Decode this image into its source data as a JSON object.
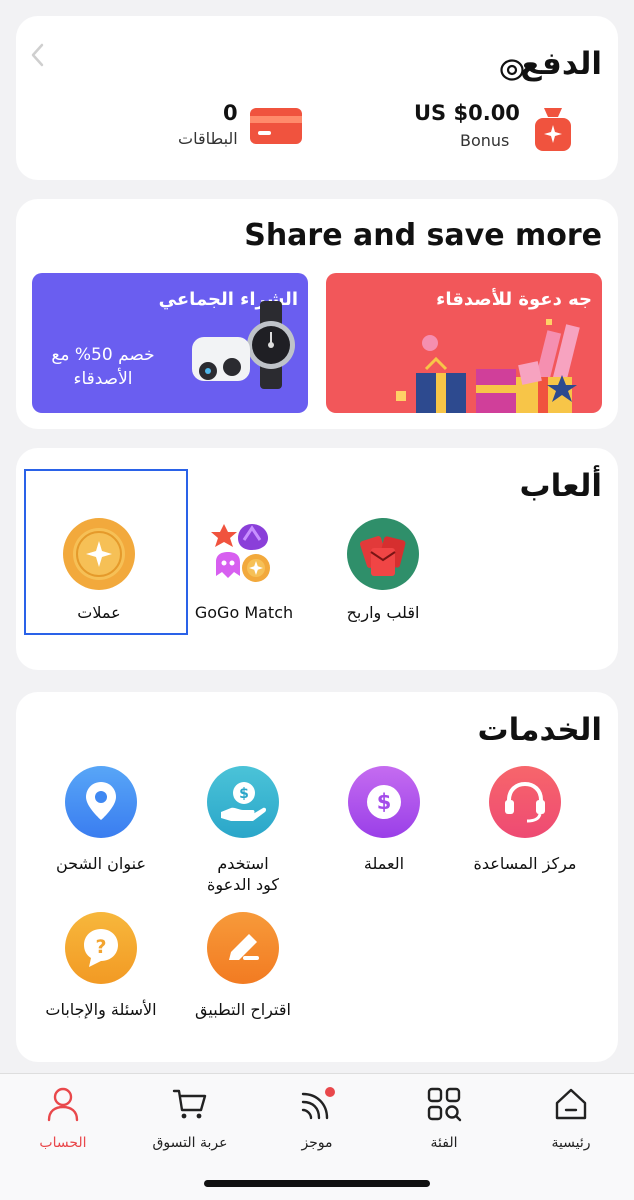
{
  "payment": {
    "title": "الدفع",
    "bonus_value": "US $0.00",
    "bonus_label": "Bonus",
    "cards_count": "0",
    "cards_label": "البطاقات"
  },
  "share": {
    "title": "Share and save more",
    "invite_title": "جه دعوة للأصدقاء",
    "group_title": "الشراء الجماعي",
    "group_sub": "خصم 50% مع الأصدقاء"
  },
  "games": {
    "title": "ألعاب",
    "items": [
      {
        "label": "اقلب واربح",
        "icon": "red-envelopes-icon"
      },
      {
        "label": "GoGo Match",
        "icon": "gogo-match-icon"
      },
      {
        "label": "عملات",
        "icon": "coin-icon"
      }
    ]
  },
  "services": {
    "title": "الخدمات",
    "items": [
      {
        "label": "مركز المساعدة",
        "icon": "headset-icon"
      },
      {
        "label": "العملة",
        "icon": "dollar-icon"
      },
      {
        "label": "استخدم كود الدعوة",
        "label_line1": "استخدم",
        "label_line2": "كود الدعوة",
        "icon": "hand-coin-icon"
      },
      {
        "label": "عنوان الشحن",
        "icon": "location-pin-icon"
      },
      {
        "label": "اقتراح التطبيق",
        "icon": "pencil-icon"
      },
      {
        "label": "الأسئلة والإجابات",
        "icon": "question-icon"
      }
    ]
  },
  "nav": {
    "items": [
      {
        "label": "رئيسية",
        "icon": "home-icon"
      },
      {
        "label": "الفئة",
        "icon": "category-icon"
      },
      {
        "label": "موجز",
        "icon": "feed-icon"
      },
      {
        "label": "عربة التسوق",
        "icon": "cart-icon"
      },
      {
        "label": "الحساب",
        "icon": "account-icon"
      }
    ],
    "active_color": "#e9484b"
  },
  "colors": {
    "accent": "#e9484b",
    "highlight": "#2a62e8",
    "group_banner": "#6a5ef0",
    "invite_banner": "#f2575a"
  }
}
